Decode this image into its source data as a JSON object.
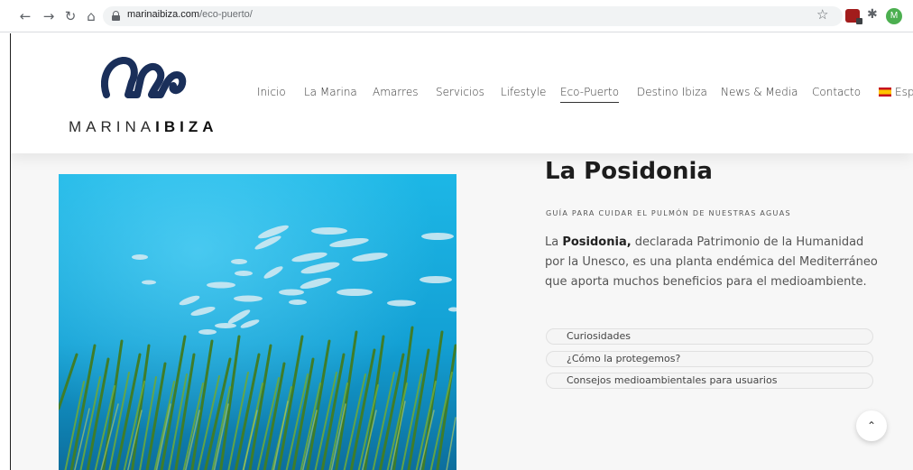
{
  "browser": {
    "url_domain": "marinaibiza.com",
    "url_path": "/eco-puerto/",
    "back_icon": "arrow-left-icon",
    "forward_icon": "arrow-right-icon",
    "reload_icon": "reload-icon",
    "home_icon": "home-icon",
    "avatar_initial": "M"
  },
  "site": {
    "logo_text_light": "MARINA",
    "logo_text_bold": "IBIZA",
    "nav": [
      "Inicio",
      "La Marina",
      "Amarres",
      "Servicios",
      "Lifestyle",
      "Eco-Puerto",
      "Destino Ibiza",
      "News & Media",
      "Contacto"
    ],
    "active_nav": "Eco-Puerto",
    "language_label": "Espa"
  },
  "content": {
    "title": "La Posidonia",
    "subtitle": "GUÍA PARA CUIDAR EL PULMÓN DE NUESTRAS AGUAS",
    "intro_prefix": "La ",
    "intro_bold": "Posidonia,",
    "intro_rest": " declarada Patrimonio de la Humanidad por la Unesco, es una planta endémica del Mediterráneo que aporta muchos beneficios para el medioambiente.",
    "links": [
      "Curiosidades",
      "¿Cómo la protegemos?",
      "Consejos medioambientales para usuarios"
    ]
  },
  "colors": {
    "water_top": "#19aee0",
    "water_bottom": "#0e6fa0",
    "seagrass": "#3f7d2a"
  }
}
